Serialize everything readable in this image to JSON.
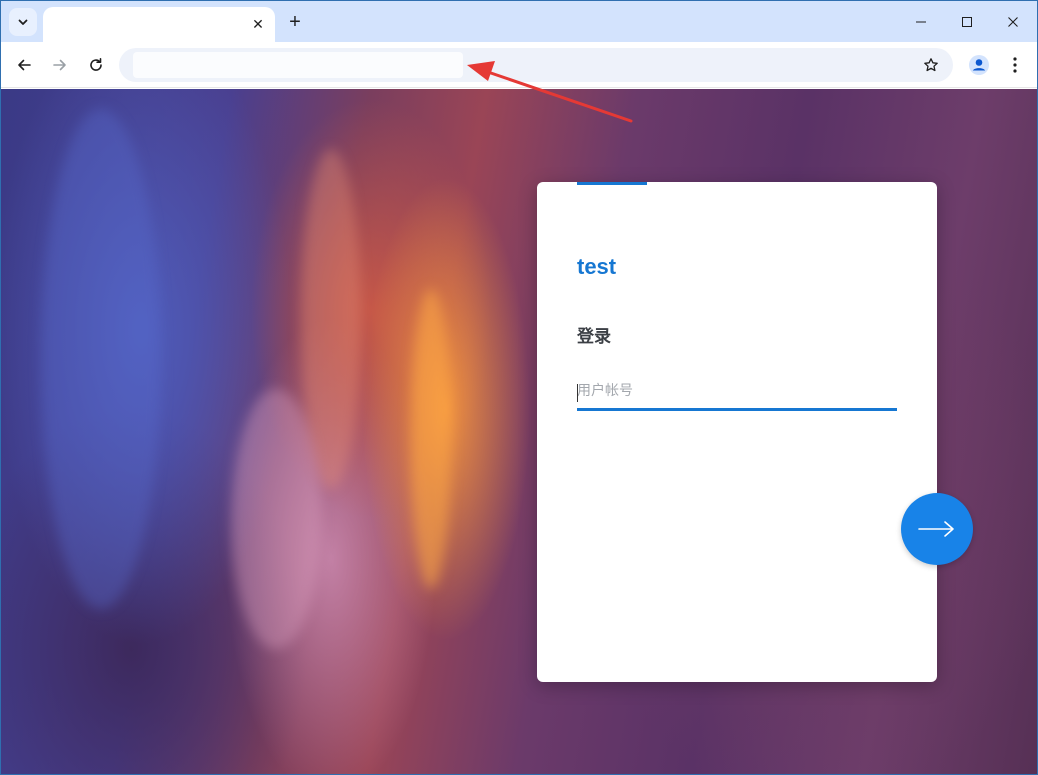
{
  "browser": {
    "tab": {
      "title": "",
      "close_icon": "close-icon"
    },
    "new_tab_glyph": "+",
    "tab_close_glyph": "✕",
    "address_bar": {
      "value": ""
    },
    "icons": [
      "tab-search-icon",
      "back-icon",
      "forward-icon",
      "reload-icon",
      "star-icon",
      "profile-icon",
      "more-vertical-icon",
      "minimize-icon",
      "maximize-icon",
      "close-icon"
    ]
  },
  "login": {
    "brand": "test",
    "title": "登录",
    "account_placeholder": "用户帐号",
    "account_value": "",
    "submit_icon": "arrow-right-icon"
  },
  "colors": {
    "accent": "#1677d2",
    "submit": "#1883e8",
    "annotation_arrow": "#e53935"
  }
}
